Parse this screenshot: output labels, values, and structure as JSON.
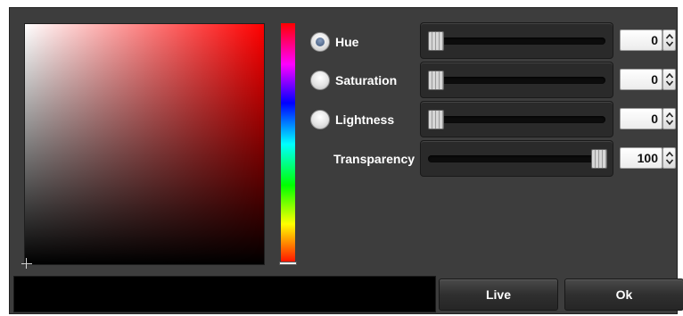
{
  "controls": {
    "hue": {
      "label": "Hue",
      "value": "0",
      "selected": true,
      "level": 0
    },
    "saturation": {
      "label": "Saturation",
      "value": "0",
      "selected": false,
      "level": 0
    },
    "lightness": {
      "label": "Lightness",
      "value": "0",
      "selected": false,
      "level": 0
    },
    "transparency": {
      "label": "Transparency",
      "value": "100",
      "level": 1
    }
  },
  "buttons": {
    "live": "Live",
    "ok": "Ok"
  },
  "preview": {
    "color": "#000000"
  },
  "field": {
    "hue_color": "#ff0000"
  },
  "icons": [
    "crosshair-icon",
    "stepper-arrows-icon"
  ]
}
